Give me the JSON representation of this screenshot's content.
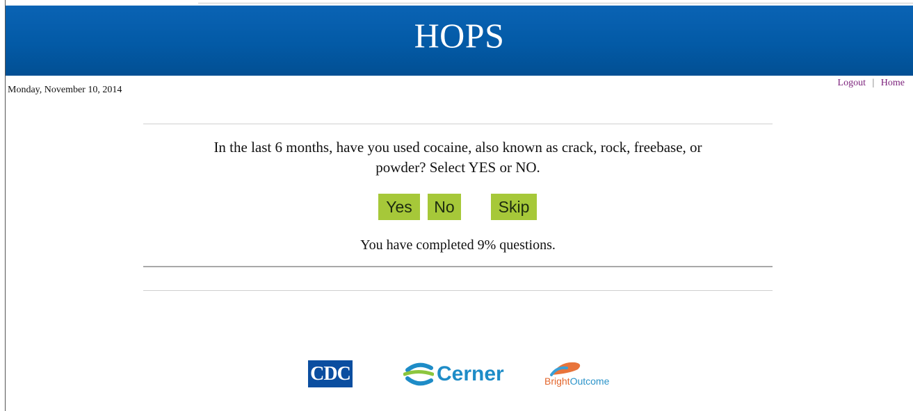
{
  "header": {
    "title": "HOPS"
  },
  "date": "Monday, November 10, 2014",
  "nav": {
    "logout": "Logout",
    "separator": "|",
    "home": "Home"
  },
  "question": {
    "line1": "In the last 6 months, have you used cocaine, also known as crack, rock, freebase, or",
    "line2": "powder? Select YES or NO."
  },
  "answers": {
    "yes": "Yes",
    "no": "No",
    "skip": "Skip"
  },
  "progress": {
    "text": "You have completed 9% questions.",
    "percent": 9
  },
  "logos": {
    "cdc": "CDC",
    "cerner": "Cerner",
    "bright_a": "Bright",
    "bright_b": "Outcome"
  },
  "colors": {
    "header": "#035aa6",
    "button": "#a6c839",
    "link": "#7a1f7a"
  }
}
